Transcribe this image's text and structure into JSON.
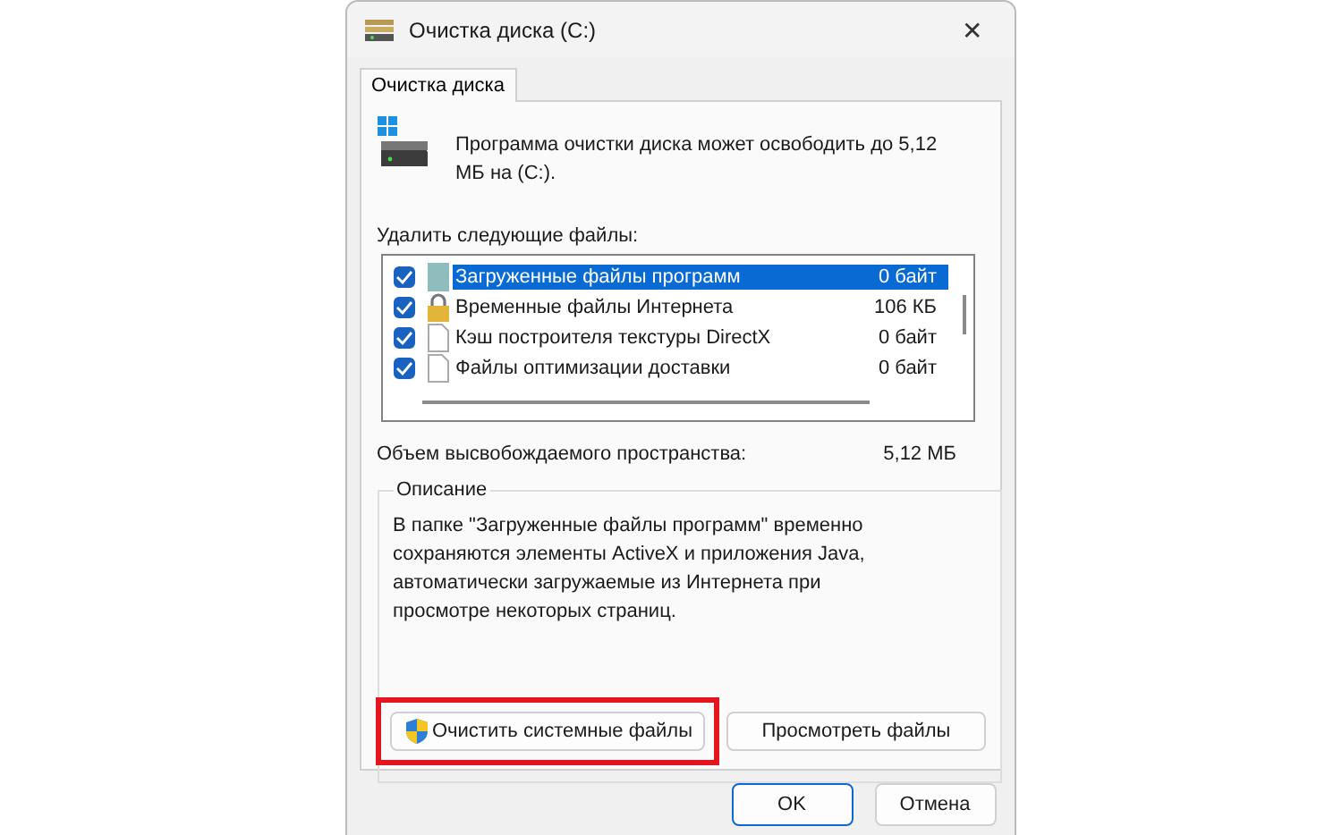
{
  "window": {
    "title": "Очистка диска  (C:)",
    "close": "✕"
  },
  "tabs": [
    {
      "label": "Очистка диска",
      "selected": true
    }
  ],
  "intro": "Программа очистки диска может освободить до 5,12 МБ на  (C:).",
  "list_label": "Удалить следующие файлы:",
  "files": [
    {
      "name": "Загруженные файлы программ",
      "size": "0 байт",
      "checked": true,
      "selected": true,
      "kind": "folder"
    },
    {
      "name": "Временные файлы Интернета",
      "size": "106 КБ",
      "checked": true,
      "selected": false,
      "kind": "lock"
    },
    {
      "name": "Кэш построителя текстуры DirectX",
      "size": "0 байт",
      "checked": true,
      "selected": false,
      "kind": "file"
    },
    {
      "name": "Файлы оптимизации доставки",
      "size": "0 байт",
      "checked": true,
      "selected": false,
      "kind": "file"
    }
  ],
  "total": {
    "label": "Объем высвобождаемого пространства:",
    "value": "5,12 МБ"
  },
  "description": {
    "title": "Описание",
    "text": "В папке \"Загруженные файлы программ\" временно сохраняются элементы ActiveX и приложения Java, автоматически загружаемые из Интернета при просмотре некоторых страниц."
  },
  "actions": [
    {
      "label": "Очистить системные файлы",
      "shield": true,
      "highlighted": true
    },
    {
      "label": "Просмотреть файлы",
      "shield": false,
      "highlighted": false
    }
  ],
  "buttons": [
    {
      "label": "OK",
      "default": true
    },
    {
      "label": "Отмена",
      "default": false
    }
  ]
}
